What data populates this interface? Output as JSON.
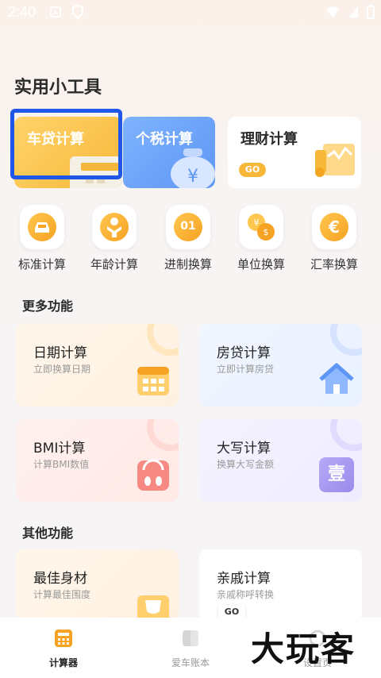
{
  "status": {
    "time": "2:40"
  },
  "page": {
    "title": "实用小工具"
  },
  "top_cards": {
    "loan": "车贷计算",
    "tax": "个税计算",
    "finance": "理财计算",
    "go": "GO"
  },
  "quick_tools": [
    {
      "label": "标准计算",
      "icon": "car-icon"
    },
    {
      "label": "年龄计算",
      "icon": "person-icon"
    },
    {
      "label": "进制换算",
      "icon": "binary-icon",
      "glyph": "01"
    },
    {
      "label": "单位换算",
      "icon": "currency-convert-icon"
    },
    {
      "label": "汇率换算",
      "icon": "euro-exchange-icon",
      "glyph": "€"
    }
  ],
  "sections": {
    "more": "更多功能",
    "other": "其他功能"
  },
  "features": [
    {
      "title": "日期计算",
      "subtitle": "立即换算日期",
      "icon": "calendar-icon"
    },
    {
      "title": "房贷计算",
      "subtitle": "立即计算房贷",
      "icon": "house-icon"
    },
    {
      "title": "BMI计算",
      "subtitle": "计算BMI数值",
      "icon": "scale-icon"
    },
    {
      "title": "大写计算",
      "subtitle": "换算大写金额",
      "icon": "chinese-numeral-icon",
      "glyph": "壹"
    },
    {
      "title": "最佳身材",
      "subtitle": "计算最佳围度",
      "icon": "body-icon"
    },
    {
      "title": "亲戚计算",
      "subtitle": "亲戚称呼转换",
      "icon": "family-icon",
      "go": "GO"
    }
  ],
  "bottom_nav": [
    {
      "label": "计算器",
      "active": true
    },
    {
      "label": "爱车账本",
      "active": false
    },
    {
      "label": "设置页",
      "active": false
    }
  ],
  "watermark": "大玩客",
  "colors": {
    "accent": "#f6a323",
    "tax_blue": "#5e96f4",
    "focus": "#1f57e8"
  }
}
